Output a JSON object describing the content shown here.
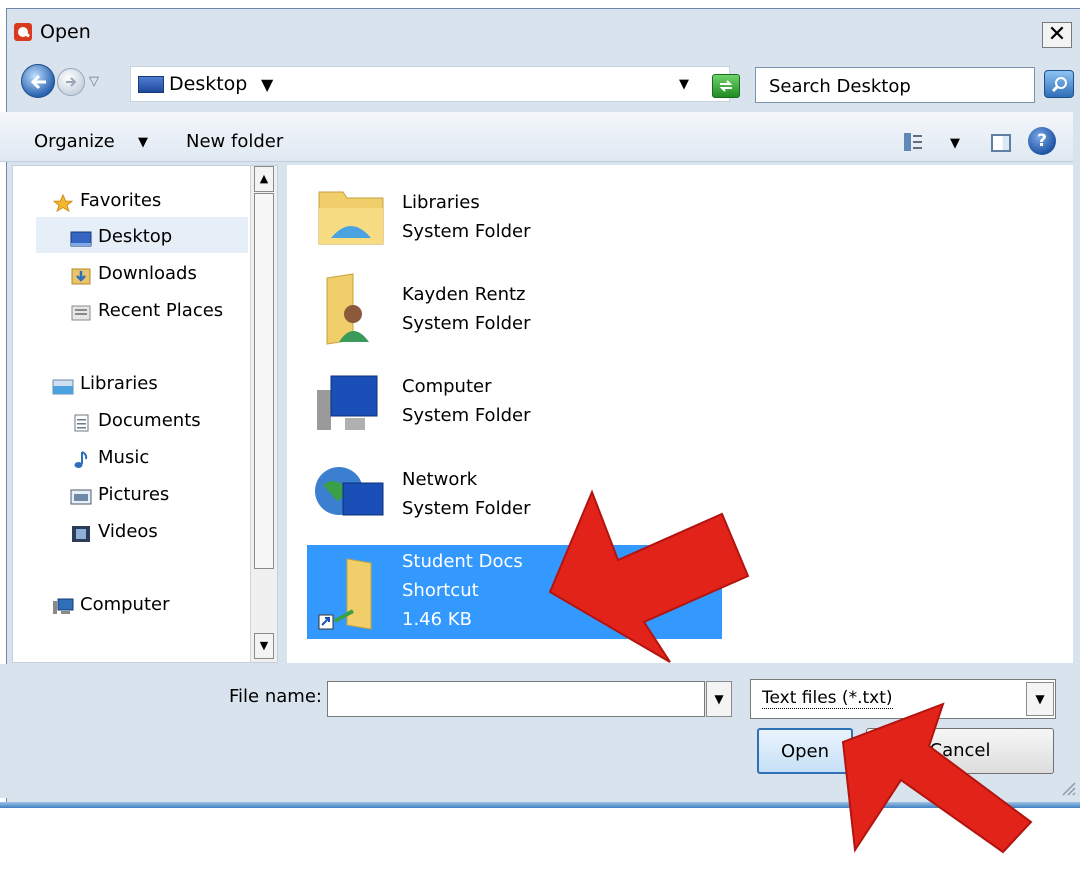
{
  "window": {
    "title": "Open",
    "close_glyph": "✕"
  },
  "nav": {
    "back_icon": "back-arrow-icon",
    "forward_icon": "forward-arrow-icon",
    "address": "Desktop",
    "search_placeholder": "Search Desktop"
  },
  "toolbar": {
    "organize": "Organize",
    "new_folder": "New folder"
  },
  "sidebar": {
    "favorites": "Favorites",
    "desktop": "Desktop",
    "downloads": "Downloads",
    "recent": "Recent Places",
    "libraries": "Libraries",
    "documents": "Documents",
    "music": "Music",
    "pictures": "Pictures",
    "videos": "Videos",
    "computer": "Computer"
  },
  "files": [
    {
      "name": "Libraries",
      "type": "System Folder"
    },
    {
      "name": "Kayden Rentz",
      "type": "System Folder"
    },
    {
      "name": "Computer",
      "type": "System Folder"
    },
    {
      "name": "Network",
      "type": "System Folder"
    },
    {
      "name": "Student Docs",
      "type": "Shortcut",
      "size": "1.46 KB"
    }
  ],
  "footer": {
    "file_name_label": "File name:",
    "file_name_value": "",
    "filter": "Text files (*.txt)",
    "open": "Open",
    "cancel": "Cancel"
  },
  "colors": {
    "selection": "#3399ff",
    "annotation_arrow": "#e2231a"
  }
}
